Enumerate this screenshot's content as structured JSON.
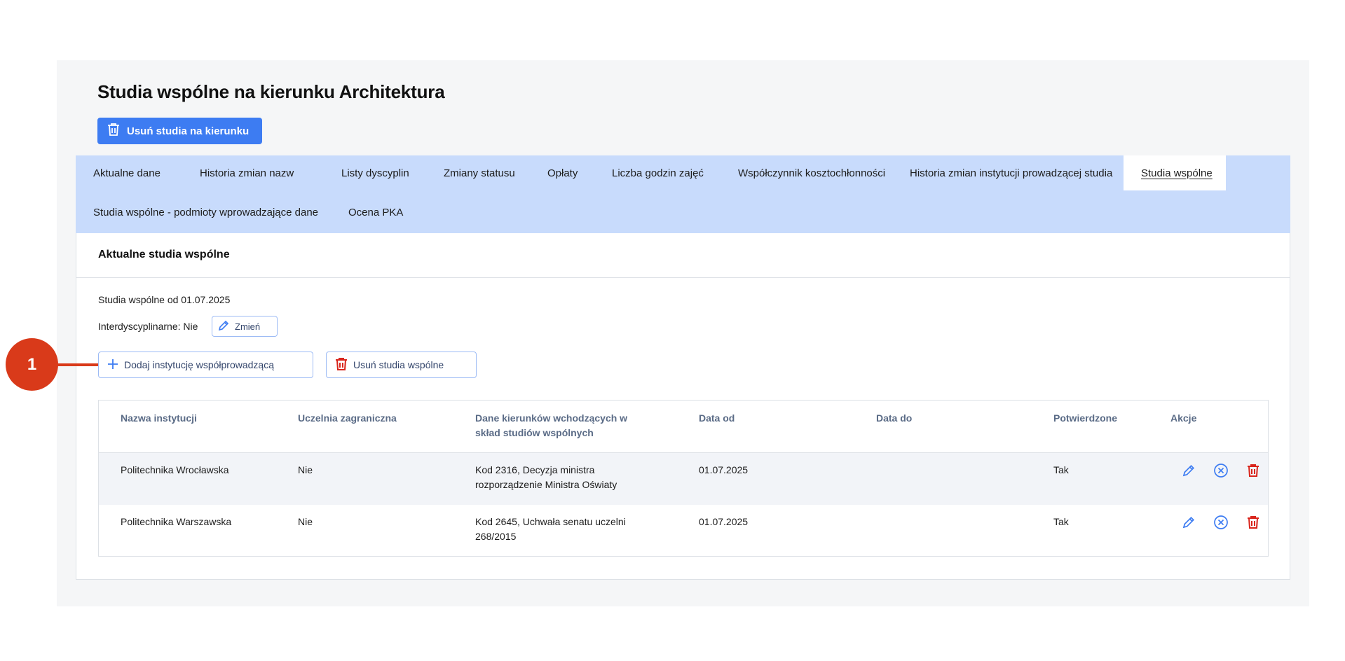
{
  "page": {
    "title": "Studia wspólne na kierunku Architektura",
    "delete_program_button": "Usuń studia na kierunku"
  },
  "tabs": [
    {
      "label": "Aktualne dane"
    },
    {
      "label": "Historia zmian nazw"
    },
    {
      "label": "Listy dyscyplin"
    },
    {
      "label": "Zmiany statusu"
    },
    {
      "label": "Opłaty"
    },
    {
      "label": "Liczba godzin zajęć"
    },
    {
      "label": "Współczynnik kosztochłonności"
    },
    {
      "label": "Historia zmian instytucji prowadzącej studia"
    },
    {
      "label": "Studia wspólne",
      "active": true
    },
    {
      "label": "Studia wspólne - podmioty wprowadzające dane"
    },
    {
      "label": "Ocena PKA"
    }
  ],
  "panel": {
    "title": "Aktualne studia wspólne",
    "since": "Studia wspólne od 01.07.2025",
    "interdisciplinary": "Interdyscyplinarne: Nie",
    "change_button": "Zmień",
    "add_institution_button": "Dodaj instytucję współprowadzącą",
    "delete_joint_button": "Usuń studia wspólne"
  },
  "table": {
    "headers": {
      "name": "Nazwa instytucji",
      "foreign": "Uczelnia zagraniczna",
      "programs_line1": "Dane kierunków wchodzących w",
      "programs_line2": "skład studiów wspólnych",
      "date_from": "Data od",
      "date_to": "Data do",
      "confirmed": "Potwierdzone",
      "actions": "Akcje"
    },
    "rows": [
      {
        "name": "Politechnika Wrocławska",
        "foreign": "Nie",
        "programs_line1": "Kod 2316, Decyzja ministra",
        "programs_line2": "rozporządzenie Ministra Oświaty",
        "date_from": "01.07.2025",
        "date_to": "",
        "confirmed": "Tak"
      },
      {
        "name": "Politechnika Warszawska",
        "foreign": "Nie",
        "programs_line1": "Kod 2645, Uchwała senatu uczelni",
        "programs_line2": "268/2015",
        "date_from": "01.07.2025",
        "date_to": "",
        "confirmed": "Tak"
      }
    ]
  },
  "callout": {
    "number": "1"
  },
  "colors": {
    "primary": "#3d7cf2",
    "tab_bar": "#c8dbfc",
    "danger": "#d9251c",
    "callout": "#d93a1a"
  },
  "icons": [
    "trash-icon",
    "pencil-icon",
    "plus-icon",
    "cancel-circle-icon"
  ]
}
